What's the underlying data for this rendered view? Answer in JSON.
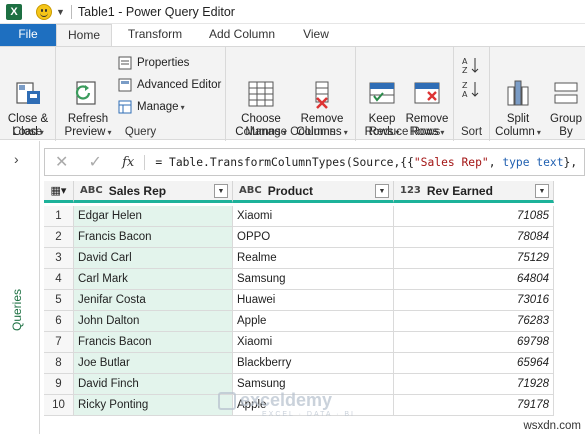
{
  "window": {
    "title": "Table1 - Power Query Editor"
  },
  "tabs": [
    {
      "label": "File"
    },
    {
      "label": "Home"
    },
    {
      "label": "Transform"
    },
    {
      "label": "Add Column"
    },
    {
      "label": "View"
    }
  ],
  "ribbon": {
    "close": {
      "button": "Close &\nLoad",
      "group": "Close"
    },
    "query": {
      "refresh": "Refresh\nPreview",
      "properties": "Properties",
      "advanced_editor": "Advanced Editor",
      "manage": "Manage",
      "group": "Query"
    },
    "manage_columns": {
      "choose": "Choose\nColumns",
      "remove": "Remove\nColumns",
      "group": "Manage Columns"
    },
    "reduce_rows": {
      "keep": "Keep\nRows",
      "remove": "Remove\nRows",
      "group": "Reduce Rows"
    },
    "sort": {
      "group": "Sort"
    },
    "split": {
      "label": "Split\nColumn"
    },
    "group_by": {
      "label": "Group\nBy"
    }
  },
  "queries_pane": {
    "label": "Queries"
  },
  "formula": {
    "fx": "fx",
    "prefix": "= Table.TransformColumnTypes(Source,{{",
    "string": "\"Sales Rep\"",
    "middle": ", ",
    "keyword": "type text",
    "suffix": "}, {"
  },
  "table": {
    "columns": [
      {
        "type_icon": "ABC",
        "name": "Sales Rep"
      },
      {
        "type_icon": "ABC",
        "name": "Product"
      },
      {
        "type_icon": "123",
        "name": "Rev Earned"
      }
    ],
    "rows": [
      {
        "n": "1",
        "rep": "Edgar Helen",
        "product": "Xiaomi",
        "rev": "71085"
      },
      {
        "n": "2",
        "rep": "Francis Bacon",
        "product": "OPPO",
        "rev": "78084"
      },
      {
        "n": "3",
        "rep": "David Carl",
        "product": "Realme",
        "rev": "75129"
      },
      {
        "n": "4",
        "rep": "Carl Mark",
        "product": "Samsung",
        "rev": "64804"
      },
      {
        "n": "5",
        "rep": "Jenifar Costa",
        "product": "Huawei",
        "rev": "73016"
      },
      {
        "n": "6",
        "rep": "John Dalton",
        "product": "Apple",
        "rev": "76283"
      },
      {
        "n": "7",
        "rep": "Francis Bacon",
        "product": "Xiaomi",
        "rev": "69798"
      },
      {
        "n": "8",
        "rep": "Joe Butlar",
        "product": "Blackberry",
        "rev": "65964"
      },
      {
        "n": "9",
        "rep": "David Finch",
        "product": "Samsung",
        "rev": "71928"
      },
      {
        "n": "10",
        "rep": "Ricky Ponting",
        "product": "Apple",
        "rev": "79178"
      }
    ]
  },
  "watermark": {
    "name": "exceldemy",
    "tagline": "EXCEL · DATA · BI"
  },
  "site": "wsxdn.com",
  "colors": {
    "accent": "#1e6fc0",
    "column_highlight": "#e3f4ec",
    "header_underline": "#1db29a",
    "excel_green": "#1d6f42"
  }
}
